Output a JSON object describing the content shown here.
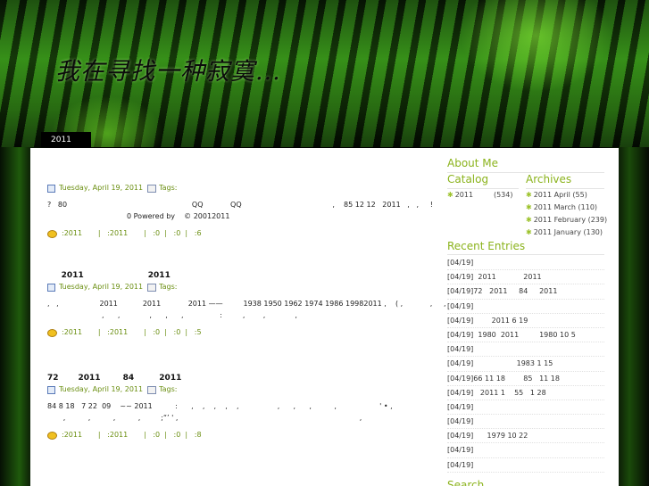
{
  "header": {
    "site_title": "我在寻找一种寂寞...",
    "nav_tab": "2011"
  },
  "posts": [
    {
      "title": "",
      "date": "Tuesday, April 19, 2011",
      "tags_label": "Tags:",
      "body_lines": [
        "?   80                                                       QQ            QQ                                        ,    85 12 12   2011   ,   ,     !",
        "                                   0 Powered by    © 20012011"
      ],
      "footer": ":2011       |   :2011       |   :0  |   :0  |   :6"
    },
    {
      "title": "     2011                       2011",
      "date": "Tuesday, April 19, 2011",
      "tags_label": "Tags:",
      "body_lines": [
        ",   ,                  2011           2011            2011 ——         1938 1950 1962 1974 1986 19982011 ,    ( ,            ,     ,",
        "                        ,      ,             ,      ,      ,                :         ,        ,             ,"
      ],
      "footer": ":2011       |   :2011       |   :0  |   :0  |   :5"
    },
    {
      "title": "72       2011        84         2011",
      "date": "Tuesday, April 19, 2011",
      "tags_label": "Tags:",
      "body_lines": [
        "84 8 18   7 22  09    ~~ 2011          :      ,    ,    ,    ,    ,                 ,      ,      ,          ,                   ' • ,",
        "       ,          ,          ,          ,         ;“’ ' ,                                                                                ,"
      ],
      "footer": ":2011       |   :2011       |   :0  |   :0  |   :8"
    }
  ],
  "sidebar": {
    "about_heading": "About Me",
    "catalog_heading": "Catalog",
    "catalog_items": [
      {
        "label": "2011         (534)"
      }
    ],
    "archives_heading": "Archives",
    "archive_items": [
      {
        "label": "2011 April (55)"
      },
      {
        "label": "2011 March (110)"
      },
      {
        "label": "2011 February (239)"
      },
      {
        "label": "2011 January (130)"
      }
    ],
    "recent_heading": "Recent Entries",
    "recent_items": [
      "[04/19]",
      "[04/19]  2011            2011",
      "[04/19]72   2011     84     2011",
      "[04/19]",
      "[04/19]        2011 6 19",
      "[04/19]  1980  2011         1980 10 5",
      "[04/19]",
      "[04/19]                   1983 1 15",
      "[04/19]66 11 18        85   11 18",
      "[04/19]   2011 1    55   1 28",
      "[04/19]",
      "[04/19]",
      "[04/19]      1979 10 22",
      "[04/19]",
      "[04/19]"
    ],
    "search_heading": "Search"
  }
}
